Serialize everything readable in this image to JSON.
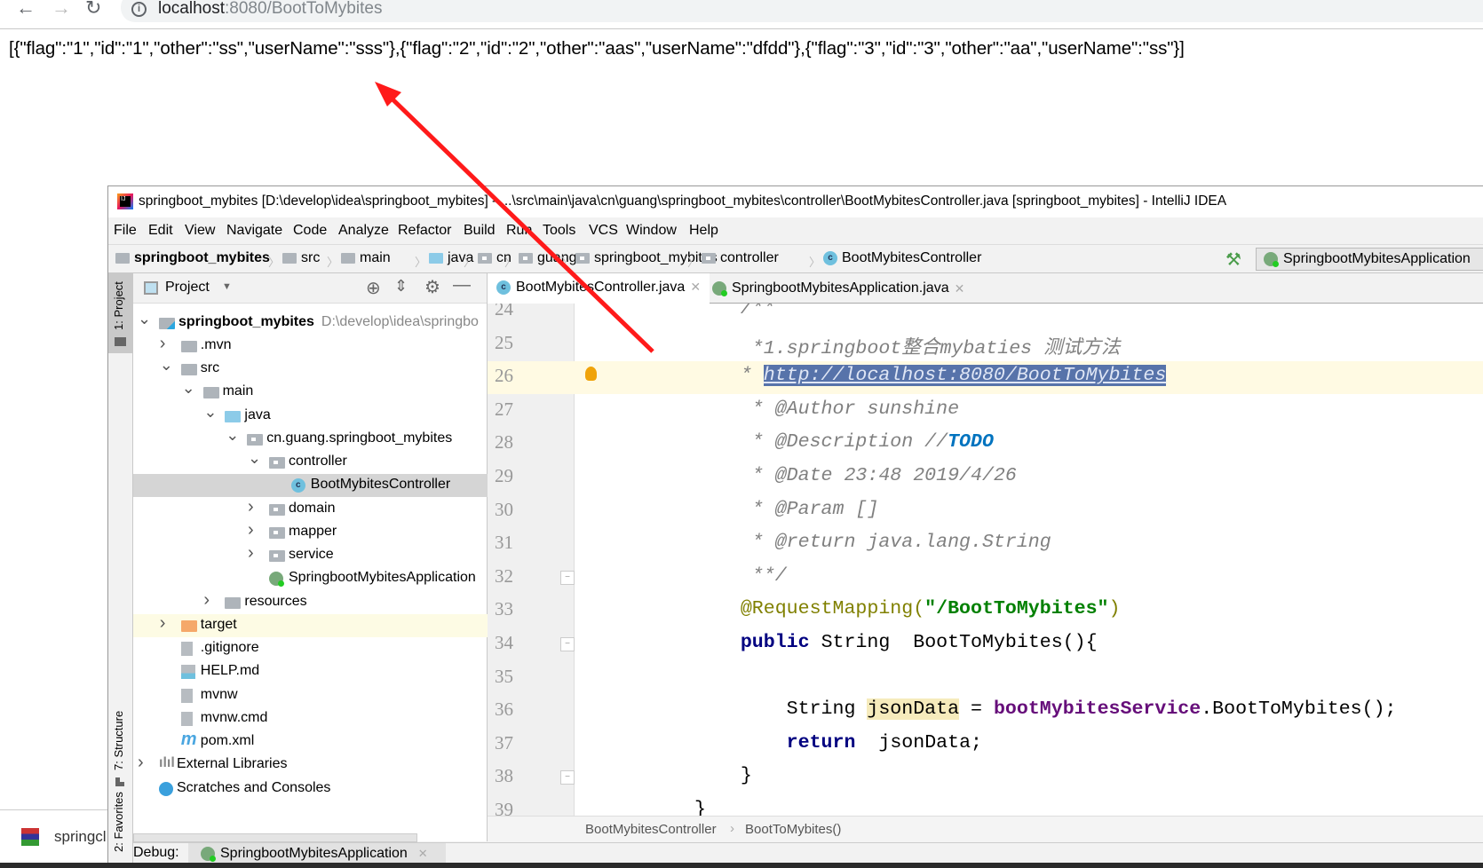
{
  "browser": {
    "back_icon": "arrow-left",
    "forward_icon": "arrow-right",
    "reload_icon": "reload",
    "url_host": "localhost",
    "url_rest": ":8080/BootToMybites",
    "json_body": "[{\"flag\":\"1\",\"id\":\"1\",\"other\":\"ss\",\"userName\":\"sss\"},{\"flag\":\"2\",\"id\":\"2\",\"other\":\"aas\",\"userName\":\"dfdd\"},{\"flag\":\"3\",\"id\":\"3\",\"other\":\"aa\",\"userName\":\"ss\"}]"
  },
  "annotation": {
    "arrow_color": "#ff1a1a"
  },
  "ide": {
    "title": "springboot_mybites [D:\\develop\\idea\\springboot_mybites] - ...\\src\\main\\java\\cn\\guang\\springboot_mybites\\controller\\BootMybitesController.java [springboot_mybites] - IntelliJ IDEA",
    "menu": [
      "File",
      "Edit",
      "View",
      "Navigate",
      "Code",
      "Analyze",
      "Refactor",
      "Build",
      "Run",
      "Tools",
      "VCS",
      "Window",
      "Help"
    ],
    "nav": [
      "springboot_mybites",
      "src",
      "main",
      "java",
      "cn",
      "guang",
      "springboot_mybites",
      "controller",
      "BootMybitesController"
    ],
    "run_config": "SpringbootMybitesApplication",
    "left_tabs": {
      "project": "1: Project",
      "structure": "7: Structure",
      "favorites": "2: Favorites"
    },
    "project_panel": {
      "title": "Project"
    },
    "tree": [
      {
        "level": 0,
        "arrow": "down",
        "icon": "module",
        "label": "springboot_mybites",
        "path": "D:\\develop\\idea\\springbo",
        "bold": true
      },
      {
        "level": 1,
        "arrow": "right",
        "icon": "folder",
        "label": ".mvn"
      },
      {
        "level": 1,
        "arrow": "down",
        "icon": "folder",
        "label": "src"
      },
      {
        "level": 2,
        "arrow": "down",
        "icon": "folder",
        "label": "main"
      },
      {
        "level": 3,
        "arrow": "down",
        "icon": "folder-blue",
        "label": "java"
      },
      {
        "level": 4,
        "arrow": "down",
        "icon": "package",
        "label": "cn.guang.springboot_mybites"
      },
      {
        "level": 5,
        "arrow": "down",
        "icon": "package",
        "label": "controller"
      },
      {
        "level": 6,
        "arrow": "",
        "icon": "class",
        "label": "BootMybitesController",
        "selected": true
      },
      {
        "level": 5,
        "arrow": "right",
        "icon": "package",
        "label": "domain"
      },
      {
        "level": 5,
        "arrow": "right",
        "icon": "package",
        "label": "mapper"
      },
      {
        "level": 5,
        "arrow": "right",
        "icon": "package",
        "label": "service"
      },
      {
        "level": 5,
        "arrow": "",
        "icon": "spring-class",
        "label": "SpringbootMybitesApplication"
      },
      {
        "level": 3,
        "arrow": "right",
        "icon": "folder",
        "label": "resources"
      },
      {
        "level": 1,
        "arrow": "right",
        "icon": "folder-orange",
        "label": "target",
        "highlight": true
      },
      {
        "level": 1,
        "arrow": "",
        "icon": "file",
        "label": ".gitignore"
      },
      {
        "level": 1,
        "arrow": "",
        "icon": "file-md",
        "label": "HELP.md"
      },
      {
        "level": 1,
        "arrow": "",
        "icon": "file",
        "label": "mvnw"
      },
      {
        "level": 1,
        "arrow": "",
        "icon": "file",
        "label": "mvnw.cmd"
      },
      {
        "level": 1,
        "arrow": "",
        "icon": "maven",
        "label": "pom.xml"
      },
      {
        "level": 0,
        "arrow": "right",
        "icon": "libraries",
        "label": "External Libraries"
      },
      {
        "level": 0,
        "arrow": "",
        "icon": "scratches",
        "label": "Scratches and Consoles"
      }
    ],
    "tabs": [
      {
        "label": "BootMybitesController.java",
        "active": true,
        "icon": "class"
      },
      {
        "label": "SpringbootMybitesApplication.java",
        "active": false,
        "icon": "spring-class"
      }
    ],
    "code": [
      {
        "n": "24",
        "t": [
          [
            "    /**",
            "comment"
          ]
        ]
      },
      {
        "n": "25",
        "t": [
          [
            "     *1.springboot整合mybaties 测试方法",
            "comment"
          ]
        ]
      },
      {
        "n": "26",
        "cur": true,
        "bulb": true,
        "t": [
          [
            "    * ",
            "comment"
          ],
          [
            "http://localhost:8080/BootToMybites",
            "sel"
          ]
        ]
      },
      {
        "n": "27",
        "t": [
          [
            "     * @Author sunshine",
            "comment"
          ]
        ]
      },
      {
        "n": "28",
        "t": [
          [
            "     * @Description //",
            "comment"
          ],
          [
            "TODO",
            "todo"
          ]
        ]
      },
      {
        "n": "29",
        "t": [
          [
            "     * @Date 23:48 2019/4/26",
            "comment"
          ]
        ]
      },
      {
        "n": "30",
        "t": [
          [
            "     * @Param []",
            "comment"
          ]
        ]
      },
      {
        "n": "31",
        "t": [
          [
            "     * @return java.lang.String",
            "comment"
          ]
        ]
      },
      {
        "n": "32",
        "fold": true,
        "t": [
          [
            "     **/",
            "comment"
          ]
        ]
      },
      {
        "n": "33",
        "t": [
          [
            "    @RequestMapping(",
            "ann"
          ],
          [
            "\"/BootToMybites\"",
            "str"
          ],
          [
            ")",
            "ann"
          ]
        ]
      },
      {
        "n": "34",
        "fold": true,
        "t": [
          [
            "    ",
            "plain"
          ],
          [
            "public",
            "kw"
          ],
          [
            " String  BootToMybites(){",
            "plain"
          ]
        ]
      },
      {
        "n": "35",
        "t": [
          [
            "",
            "plain"
          ]
        ]
      },
      {
        "n": "36",
        "t": [
          [
            "        String ",
            "plain"
          ],
          [
            "jsonData",
            "hlvar"
          ],
          [
            " = ",
            "plain"
          ],
          [
            "bootMybitesService",
            "field"
          ],
          [
            ".BootToMybites();",
            "plain"
          ]
        ]
      },
      {
        "n": "37",
        "t": [
          [
            "        ",
            "plain"
          ],
          [
            "return",
            "kw"
          ],
          [
            "  jsonData;",
            "plain"
          ]
        ]
      },
      {
        "n": "38",
        "fold": true,
        "t": [
          [
            "    }",
            "plain"
          ]
        ]
      },
      {
        "n": "39",
        "t": [
          [
            "}",
            "plain"
          ]
        ]
      }
    ],
    "breadcrumb": [
      "BootMybitesController",
      "BootToMybites()"
    ],
    "debug": {
      "label": "Debug:",
      "tab": "SpringbootMybitesApplication"
    }
  },
  "taskbar": {
    "item_label": "springcl"
  }
}
